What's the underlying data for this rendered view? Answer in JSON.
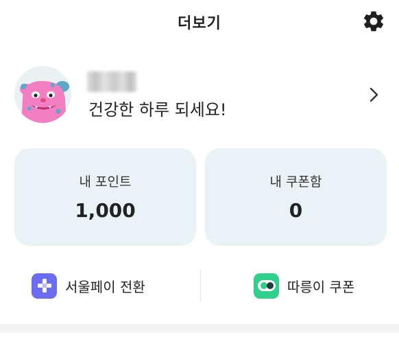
{
  "header": {
    "title": "더보기",
    "settings_icon": "gear-icon"
  },
  "profile": {
    "avatar_icon": "pink-monster-avatar",
    "greeting": "건강한 하루 되세요!",
    "chevron_icon": "chevron-right-icon"
  },
  "cards": {
    "points": {
      "label": "내 포인트",
      "value": "1,000"
    },
    "coupons": {
      "label": "내 쿠폰함",
      "value": "0"
    }
  },
  "quick_links": {
    "seoulpay": {
      "label": "서울페이 전환",
      "icon": "plus-icon",
      "color": "#6b6cf0"
    },
    "ddareungi": {
      "label": "따릉이 쿠폰",
      "icon": "bike-toggle-icon",
      "color": "#2fd08a"
    }
  },
  "colors": {
    "card_bg": "#e9f3f6",
    "text": "#222222"
  }
}
